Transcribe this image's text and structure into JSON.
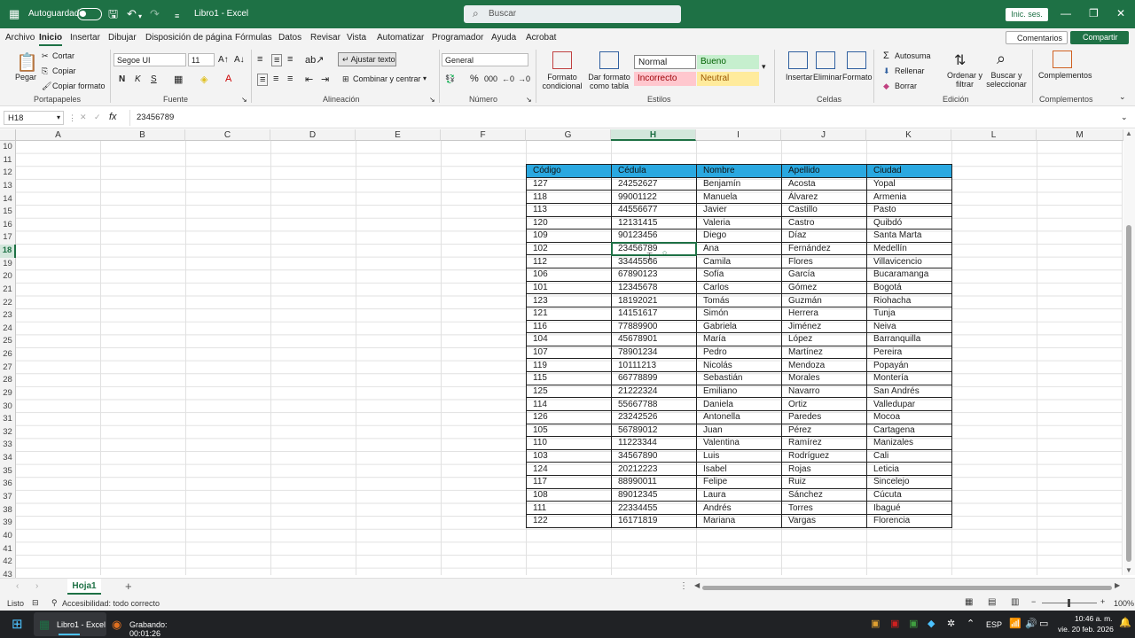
{
  "titlebar": {
    "autosave_label": "Autoguardado",
    "doc_title": "Libro1 - Excel",
    "search_placeholder": "Buscar",
    "signin": "Inic. ses."
  },
  "menu": {
    "items": [
      "Archivo",
      "Inicio",
      "Insertar",
      "Dibujar",
      "Disposición de página",
      "Fórmulas",
      "Datos",
      "Revisar",
      "Vista",
      "Automatizar",
      "Programador",
      "Ayuda",
      "Acrobat"
    ],
    "comments": "Comentarios",
    "share": "Compartir"
  },
  "ribbon": {
    "portapapeles": {
      "paste": "Pegar",
      "cut": "Cortar",
      "copy": "Copiar",
      "format_painter": "Copiar formato",
      "label": "Portapapeles"
    },
    "fuente": {
      "font": "Segoe UI",
      "size": "11",
      "bold": "N",
      "italic": "K",
      "underline": "S",
      "label": "Fuente"
    },
    "alineacion": {
      "wrap": "Ajustar texto",
      "merge": "Combinar y centrar",
      "label": "Alineación"
    },
    "numero": {
      "format": "General",
      "label": "Número"
    },
    "estilos": {
      "cond": "Formato condicional",
      "table": "Dar formato como tabla",
      "normal": "Normal",
      "bueno": "Bueno",
      "incorrecto": "Incorrecto",
      "neutral": "Neutral",
      "label": "Estilos"
    },
    "celdas": {
      "insert": "Insertar",
      "delete": "Eliminar",
      "format": "Formato",
      "label": "Celdas"
    },
    "edicion": {
      "autosum": "Autosuma",
      "fill": "Rellenar",
      "clear": "Borrar",
      "sort": "Ordenar y filtrar",
      "find": "Buscar y seleccionar",
      "label": "Edición"
    },
    "complementos": {
      "addins": "Complementos",
      "label": "Complementos"
    }
  },
  "formula": {
    "namebox": "H18",
    "fx": "fx",
    "value": "23456789"
  },
  "columns": [
    "A",
    "B",
    "C",
    "D",
    "E",
    "F",
    "G",
    "H",
    "I",
    "J",
    "K",
    "L",
    "M"
  ],
  "rows": [
    "10",
    "11",
    "12",
    "13",
    "14",
    "15",
    "16",
    "17",
    "18",
    "19",
    "20",
    "21",
    "22",
    "23",
    "24",
    "25",
    "26",
    "27",
    "28",
    "29",
    "30",
    "31",
    "32",
    "33",
    "34",
    "35",
    "36",
    "37",
    "38",
    "39",
    "40",
    "41",
    "42",
    "43"
  ],
  "table": {
    "headers": [
      "Código",
      "Cédula",
      "Nombre",
      "Apellido",
      "Ciudad"
    ],
    "rows": [
      [
        "127",
        "24252627",
        "Benjamín",
        "Acosta",
        "Yopal"
      ],
      [
        "118",
        "99001122",
        "Manuela",
        "Álvarez",
        "Armenia"
      ],
      [
        "113",
        "44556677",
        "Javier",
        "Castillo",
        "Pasto"
      ],
      [
        "120",
        "12131415",
        "Valeria",
        "Castro",
        "Quibdó"
      ],
      [
        "109",
        "90123456",
        "Diego",
        "Díaz",
        "Santa Marta"
      ],
      [
        "102",
        "23456789",
        "Ana",
        "Fernández",
        "Medellín"
      ],
      [
        "112",
        "33445566",
        "Camila",
        "Flores",
        "Villavicencio"
      ],
      [
        "106",
        "67890123",
        "Sofía",
        "García",
        "Bucaramanga"
      ],
      [
        "101",
        "12345678",
        "Carlos",
        "Gómez",
        "Bogotá"
      ],
      [
        "123",
        "18192021",
        "Tomás",
        "Guzmán",
        "Riohacha"
      ],
      [
        "121",
        "14151617",
        "Simón",
        "Herrera",
        "Tunja"
      ],
      [
        "116",
        "77889900",
        "Gabriela",
        "Jiménez",
        "Neiva"
      ],
      [
        "104",
        "45678901",
        "María",
        "López",
        "Barranquilla"
      ],
      [
        "107",
        "78901234",
        "Pedro",
        "Martínez",
        "Pereira"
      ],
      [
        "119",
        "10111213",
        "Nicolás",
        "Mendoza",
        "Popayán"
      ],
      [
        "115",
        "66778899",
        "Sebastián",
        "Morales",
        "Montería"
      ],
      [
        "125",
        "21222324",
        "Emiliano",
        "Navarro",
        "San Andrés"
      ],
      [
        "114",
        "55667788",
        "Daniela",
        "Ortiz",
        "Valledupar"
      ],
      [
        "126",
        "23242526",
        "Antonella",
        "Paredes",
        "Mocoa"
      ],
      [
        "105",
        "56789012",
        "Juan",
        "Pérez",
        "Cartagena"
      ],
      [
        "110",
        "11223344",
        "Valentina",
        "Ramírez",
        "Manizales"
      ],
      [
        "103",
        "34567890",
        "Luis",
        "Rodríguez",
        "Cali"
      ],
      [
        "124",
        "20212223",
        "Isabel",
        "Rojas",
        "Leticia"
      ],
      [
        "117",
        "88990011",
        "Felipe",
        "Ruiz",
        "Sincelejo"
      ],
      [
        "108",
        "89012345",
        "Laura",
        "Sánchez",
        "Cúcuta"
      ],
      [
        "111",
        "22334455",
        "Andrés",
        "Torres",
        "Ibagué"
      ],
      [
        "122",
        "16171819",
        "Mariana",
        "Vargas",
        "Florencia"
      ]
    ]
  },
  "sheet": {
    "tab": "Hoja1"
  },
  "status": {
    "ready": "Listo",
    "accessibility": "Accesibilidad: todo correcto",
    "zoom": "100%"
  },
  "taskbar": {
    "excel": "Libro1 - Excel",
    "recording": "Grabando: 00:01:26",
    "lang": "ESP",
    "time": "10:46 a. m.",
    "date": "vie. 20 feb. 2026"
  }
}
